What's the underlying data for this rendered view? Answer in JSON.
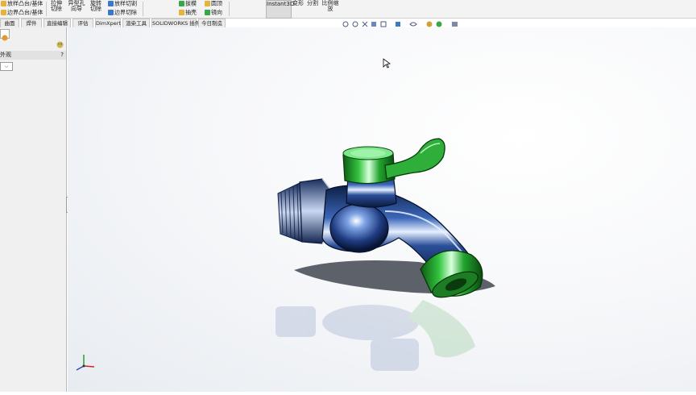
{
  "ribbon": {
    "features": {
      "boss_loft": "放样凸台/基体",
      "boundary_boss": "边界凸台/基体",
      "extruded_cut": "拉伸切除",
      "hole_wizard": "异型孔向导",
      "revolved_cut": "旋转切除",
      "lofted_cut": "放样切割",
      "boundary_cut": "边界切除",
      "draft": "拔模",
      "shell": "抽壳",
      "dome": "圆顶",
      "mirror": "镜向"
    },
    "instant3d": "Instant3D",
    "deform": "变形",
    "split": "分割",
    "scale": "比例缩放"
  },
  "tabs": [
    "曲面",
    "焊件",
    "直接编辑",
    "评估",
    "DimXpert",
    "渲染工具",
    "SOLIDWORKS 插件",
    "今日制造"
  ],
  "panel": {
    "title": "外观",
    "help": "?",
    "dropdown_arrow": "⌵"
  },
  "icons": {
    "view_toolbar": [
      "zoom-fit-icon",
      "zoom-area-icon",
      "previous-view-icon",
      "section-view-icon",
      "view-orientation-icon",
      "display-style-icon",
      "hide-show-icon",
      "appearance-icon",
      "scene-icon",
      "view-settings-icon"
    ]
  },
  "colors": {
    "body_blue": "#1a3a78",
    "handle_green": "#1f9a2a",
    "toolbar_bg": "#f3f3f3"
  }
}
